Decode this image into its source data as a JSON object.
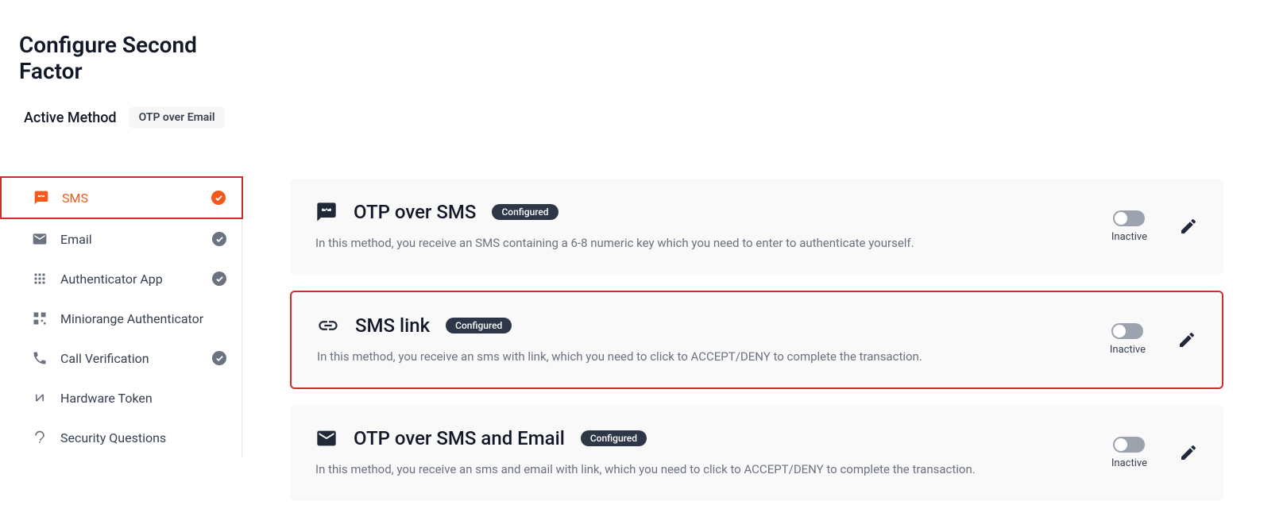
{
  "page_title": "Configure Second Factor",
  "active_method": {
    "label": "Active Method",
    "value": "OTP over Email"
  },
  "sidebar": {
    "items": [
      {
        "label": "SMS",
        "checked": true,
        "active": true,
        "icon": "sms"
      },
      {
        "label": "Email",
        "checked": true,
        "active": false,
        "icon": "email"
      },
      {
        "label": "Authenticator App",
        "checked": true,
        "active": false,
        "icon": "apps"
      },
      {
        "label": "Miniorange Authenticator",
        "checked": false,
        "active": false,
        "icon": "qr"
      },
      {
        "label": "Call Verification",
        "checked": true,
        "active": false,
        "icon": "call"
      },
      {
        "label": "Hardware Token",
        "checked": false,
        "active": false,
        "icon": "token"
      },
      {
        "label": "Security Questions",
        "checked": false,
        "active": false,
        "icon": "question"
      }
    ]
  },
  "methods": [
    {
      "title": "OTP over SMS",
      "badge": "Configured",
      "desc": "In this method, you receive an SMS containing a 6-8 numeric key which you need to enter to authenticate yourself.",
      "status": "Inactive",
      "highlighted": false,
      "icon": "sms"
    },
    {
      "title": "SMS link",
      "badge": "Configured",
      "desc": "In this method, you receive an sms with link, which you need to click to ACCEPT/DENY to complete the transaction.",
      "status": "Inactive",
      "highlighted": true,
      "icon": "link"
    },
    {
      "title": "OTP over SMS and Email",
      "badge": "Configured",
      "desc": "In this method, you receive an sms and email with link, which you need to click to ACCEPT/DENY to complete the transaction.",
      "status": "Inactive",
      "highlighted": false,
      "icon": "email"
    }
  ]
}
